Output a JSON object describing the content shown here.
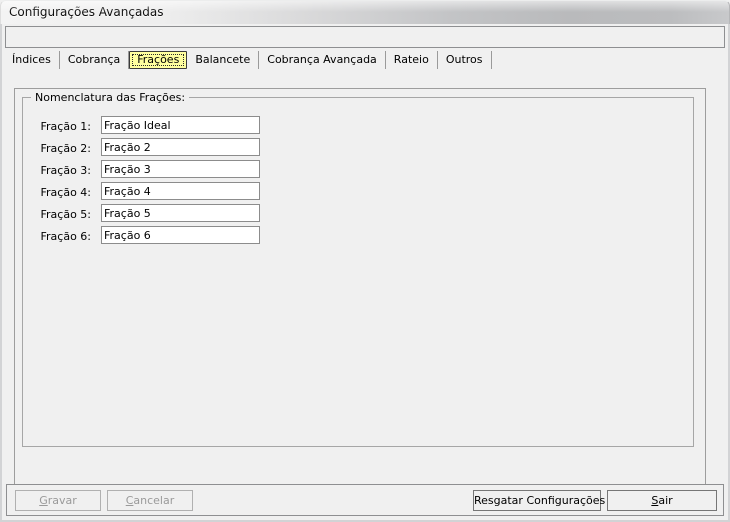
{
  "window": {
    "title": "Configurações Avançadas"
  },
  "tabs": [
    {
      "label": "Índices",
      "active": false
    },
    {
      "label": "Cobrança",
      "active": false
    },
    {
      "label": "Frações",
      "active": true
    },
    {
      "label": "Balancete",
      "active": false
    },
    {
      "label": "Cobrança Avançada",
      "active": false
    },
    {
      "label": "Rateio",
      "active": false
    },
    {
      "label": "Outros",
      "active": false
    }
  ],
  "group": {
    "legend": "Nomenclatura das Frações:"
  },
  "fields": [
    {
      "label": "Fração 1:",
      "value": "Fração Ideal"
    },
    {
      "label": "Fração 2:",
      "value": "Fração 2"
    },
    {
      "label": "Fração 3:",
      "value": "Fração 3"
    },
    {
      "label": "Fração 4:",
      "value": "Fração 4"
    },
    {
      "label": "Fração 5:",
      "value": "Fração 5"
    },
    {
      "label": "Fração 6:",
      "value": "Fração 6"
    }
  ],
  "buttons": {
    "gravar": {
      "label": "Gravar",
      "accel": "G",
      "rest": "ravar",
      "disabled": true
    },
    "cancelar": {
      "label": "Cancelar",
      "accel": "C",
      "rest": "ancelar",
      "disabled": true
    },
    "resgatar": {
      "label": "Resgatar Configurações",
      "disabled": false
    },
    "sair": {
      "label": "Sair",
      "accel": "S",
      "rest": "air",
      "disabled": false
    }
  },
  "colors": {
    "active_tab_bg": "#ffff9e",
    "window_bg": "#f0f0f0",
    "field_bg": "#ffffff",
    "border": "#8c8c8c",
    "disabled_text": "#9a9a9a"
  }
}
